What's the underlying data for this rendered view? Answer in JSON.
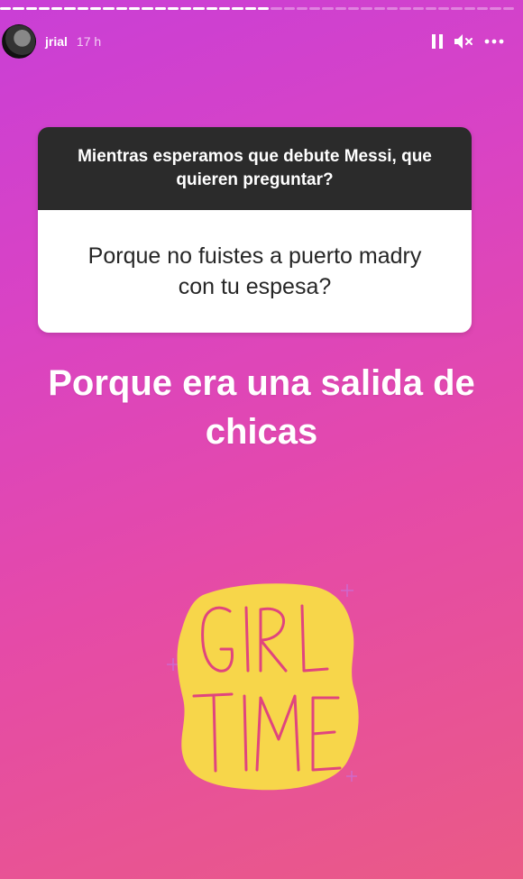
{
  "story": {
    "username": "jrial",
    "time": "17 h",
    "progress": {
      "segments": 40,
      "completed": 21
    }
  },
  "question_card": {
    "prompt": "Mientras esperamos que debute Messi, que quieren preguntar?",
    "question": "Porque no fuistes a puerto madry con tu espesa?"
  },
  "answer": "Porque era una salida de chicas",
  "sticker": {
    "lines": [
      "GIRL",
      "TIME"
    ],
    "bg_color": "#f7d64a",
    "text_color": "#e0457e"
  },
  "icons": [
    "pause-icon",
    "mute-icon",
    "more-icon"
  ]
}
